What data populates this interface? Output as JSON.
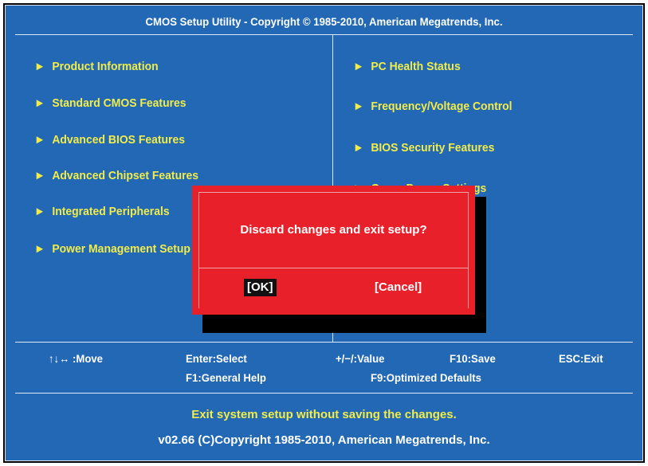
{
  "title": "CMOS Setup Utility - Copyright © 1985-2010, American Megatrends, Inc.",
  "left_menu": [
    {
      "label": "Product Information"
    },
    {
      "label": "Standard CMOS Features"
    },
    {
      "label": "Advanced BIOS Features"
    },
    {
      "label": "Advanced Chipset Features"
    },
    {
      "label": "Integrated Peripherals"
    },
    {
      "label": "Power Management Setup"
    }
  ],
  "right_menu": [
    {
      "label": "PC Health Status"
    },
    {
      "label": "Frequency/Voltage Control"
    },
    {
      "label": "BIOS Security Features"
    },
    {
      "label": "Green Power Settings"
    }
  ],
  "help": {
    "move": "↑↓↔ :Move",
    "select": "Enter:Select",
    "value": "+/−/:Value",
    "save": "F10:Save",
    "exit": "ESC:Exit",
    "general_help": "F1:General Help",
    "optimized_defaults": "F9:Optimized Defaults"
  },
  "status_line": "Exit system setup without saving the changes.",
  "version_line": "v02.66  (C)Copyright  1985-2010,  American  Megatrends,  Inc.",
  "dialog": {
    "message": "Discard changes and exit setup?",
    "ok": "[OK]",
    "cancel": "[Cancel]",
    "selected": "ok"
  },
  "colors": {
    "background": "#2268b4",
    "menu_text": "#f1ec4a",
    "dialog": "#e8202a"
  }
}
